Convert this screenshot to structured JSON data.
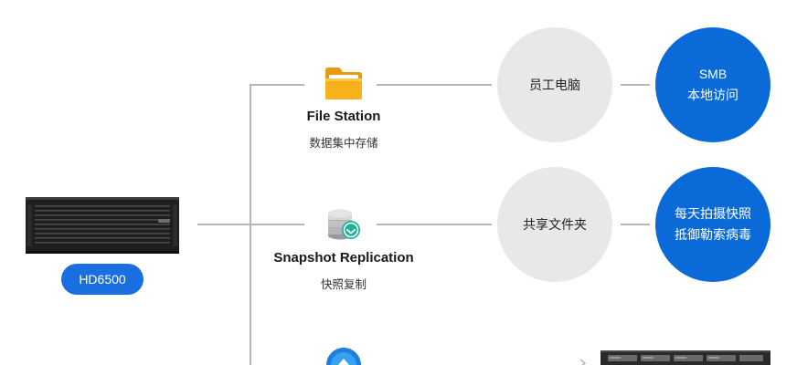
{
  "source_device": {
    "label": "HD6500",
    "icon": "nas-rack-icon"
  },
  "apps": [
    {
      "title": "File Station",
      "subtitle": "数据集中存储",
      "icon": "folder-icon",
      "feature": "员工电脑",
      "result": [
        "SMB",
        "本地访问"
      ]
    },
    {
      "title": "Snapshot Replication",
      "subtitle": "快照复制",
      "icon": "snapshot-replication-icon",
      "feature": "共享文件夹",
      "result": [
        "每天拍摄快照",
        "抵御勒索病毒"
      ]
    },
    {
      "title": "",
      "subtitle": "",
      "icon": "backup-app-icon",
      "target_device_icon": "rack-server-icon"
    }
  ],
  "colors": {
    "accent_blue": "#0a6ad8",
    "pill_blue": "#1a6fe0",
    "grey_circle": "#e8e8e8",
    "connector": "#b5b5b5",
    "folder_yellow": "#f7b21b"
  }
}
